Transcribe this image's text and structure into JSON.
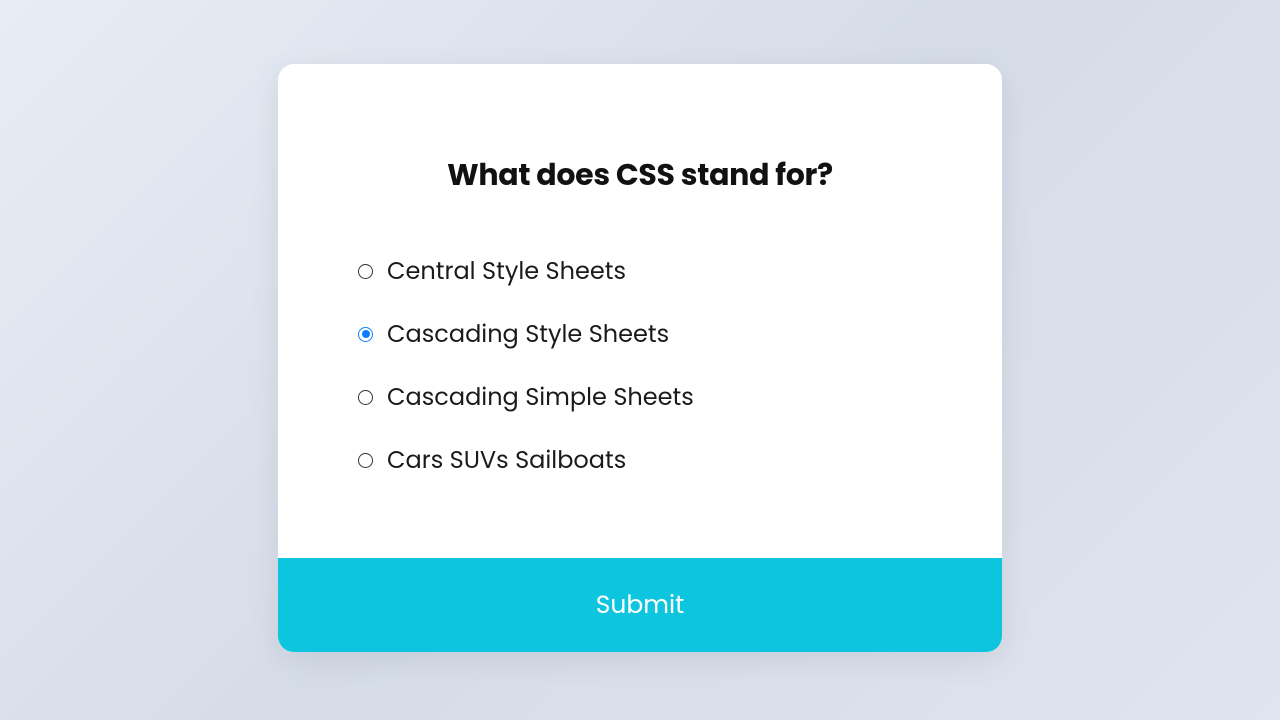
{
  "quiz": {
    "question": "What does CSS stand for?",
    "options": [
      {
        "label": "Central Style Sheets",
        "selected": false
      },
      {
        "label": "Cascading Style Sheets",
        "selected": true
      },
      {
        "label": "Cascading Simple Sheets",
        "selected": false
      },
      {
        "label": "Cars SUVs Sailboats",
        "selected": false
      }
    ],
    "submit_label": "Submit"
  },
  "colors": {
    "accent": "#0dc5de",
    "radio_selected": "#0d7eff"
  }
}
